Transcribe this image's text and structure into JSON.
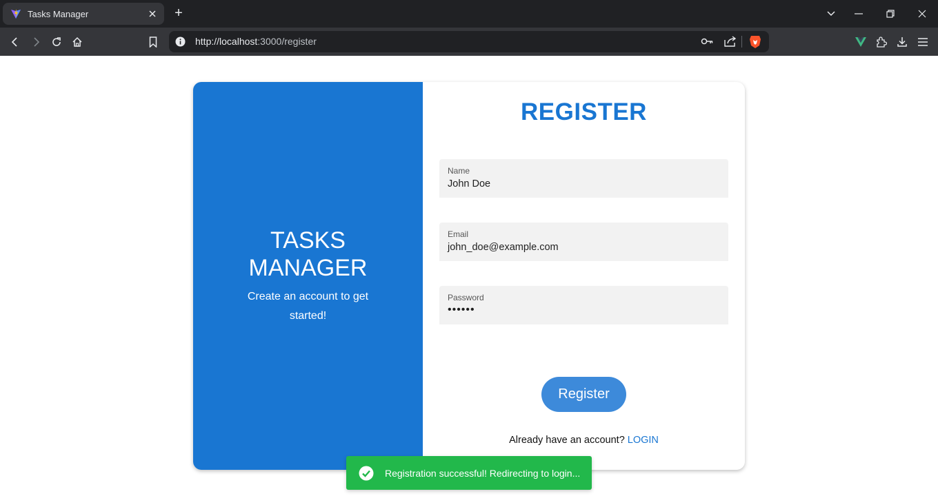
{
  "browser": {
    "tab_title": "Tasks Manager",
    "new_tab_symbol": "+",
    "url_host": "http://localhost",
    "url_path": ":3000/register",
    "icons": [
      "vite-favicon-icon",
      "close-icon",
      "plus-icon",
      "chevron-down-icon",
      "minimize-icon",
      "restore-icon",
      "close-window-icon",
      "back-icon",
      "forward-icon",
      "reload-icon",
      "home-icon",
      "bookmark-icon",
      "site-info-icon",
      "key-icon",
      "share-icon",
      "brave-shield-icon",
      "vue-devtools-icon",
      "extensions-icon",
      "download-icon",
      "menu-icon"
    ]
  },
  "left_panel": {
    "title_line1": "TASKS",
    "title_line2": "MANAGER",
    "subtitle_line1": "Create an account to get",
    "subtitle_line2": "started!",
    "color": "#1976d2"
  },
  "form": {
    "heading": "REGISTER",
    "fields": [
      {
        "label": "Name",
        "value": "John Doe"
      },
      {
        "label": "Email",
        "value": "john_doe@example.com"
      },
      {
        "label": "Password",
        "value": "••••••"
      }
    ],
    "submit_label": "Register",
    "login_prompt": "Already have an account?",
    "login_link": "LOGIN"
  },
  "toast": {
    "message": "Registration successful! Redirecting to login...",
    "color": "#22b84b",
    "icon": "check-circle-icon"
  }
}
